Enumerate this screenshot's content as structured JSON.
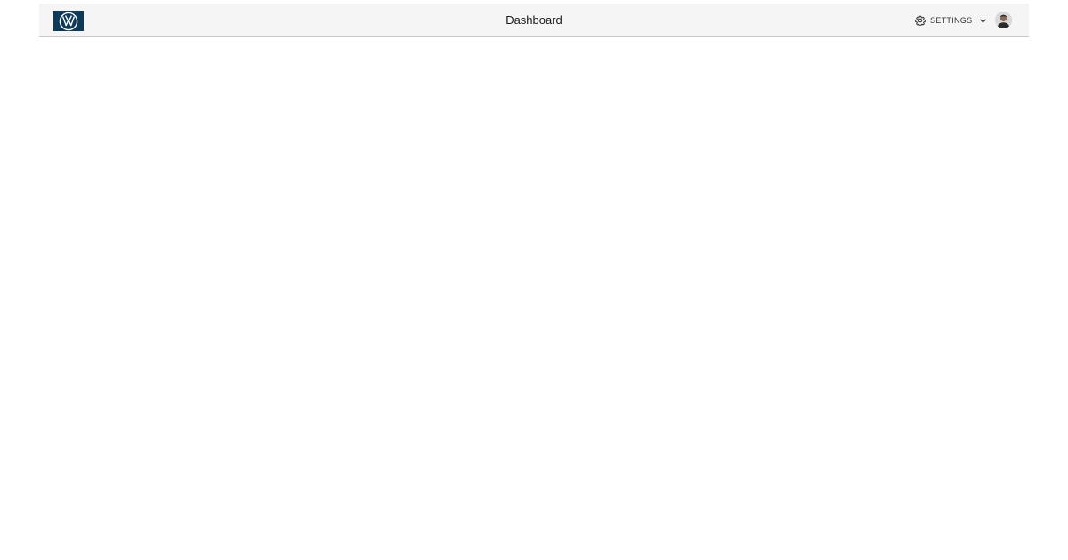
{
  "header": {
    "title": "Dashboard",
    "settings_label": "SETTINGS",
    "logo_icon": "vw-logo-icon",
    "settings_icon": "gear-icon",
    "dropdown_icon": "chevron-down-icon",
    "avatar_icon": "user-avatar"
  },
  "colors": {
    "header_bg": "#f5f5f5",
    "logo_bg": "#0e3a5a",
    "text": "#1a1a1a"
  }
}
